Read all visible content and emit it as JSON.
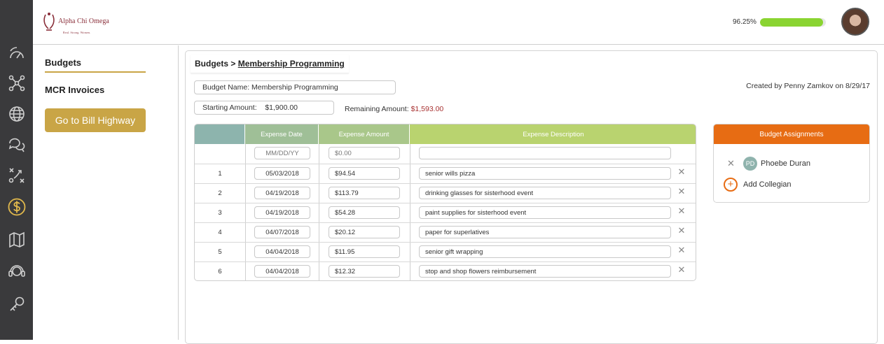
{
  "brand": {
    "name": "Alpha Chi Omega",
    "tagline": "Real. Strong. Women.",
    "accent_gold": "#c9a546",
    "accent_orange": "#e76c13",
    "accent_red": "#a83232"
  },
  "rail": {
    "icons": [
      "dashboard-gauge-icon",
      "network-nodes-icon",
      "globe-icon",
      "chat-bubbles-icon",
      "strategy-play-icon",
      "dollar-coin-icon",
      "book-map-icon",
      "support-headset-icon",
      "key-icon"
    ],
    "active": "dollar-coin-icon"
  },
  "header": {
    "progress_text": "96.25%",
    "progress_value": 0.9625
  },
  "sidenav": {
    "budgets": "Budgets",
    "mcr": "MCR Invoices",
    "bill_button": "Go to Bill Highway"
  },
  "breadcrumb": {
    "root": "Budgets",
    "sep": ">",
    "current": "Membership Programming"
  },
  "budget": {
    "name_label": "Budget Name:",
    "name_value": "Membership Programming",
    "start_label": "Starting Amount:",
    "start_value": "$1,900.00",
    "remaining_label": "Remaining Amount:",
    "remaining_value": "$1,593.00",
    "created": "Created by Penny Zamkov on 8/29/17"
  },
  "table": {
    "columns": [
      "",
      "Expense Date",
      "Expense Amount",
      "Expense Description"
    ],
    "new_row": {
      "date_placeholder": "MM/DD/YY",
      "amount_placeholder": "$0.00",
      "description": ""
    },
    "rows": [
      {
        "num": "1",
        "date": "05/03/2018",
        "amount": "$94.54",
        "description": "senior wills pizza"
      },
      {
        "num": "2",
        "date": "04/19/2018",
        "amount": "$113.79",
        "description": "drinking glasses for sisterhood event"
      },
      {
        "num": "3",
        "date": "04/19/2018",
        "amount": "$54.28",
        "description": "paint supplies for sisterhood event"
      },
      {
        "num": "4",
        "date": "04/07/2018",
        "amount": "$20.12",
        "description": "paper for superlatives"
      },
      {
        "num": "5",
        "date": "04/04/2018",
        "amount": "$11.95",
        "description": "senior gift wrapping"
      },
      {
        "num": "6",
        "date": "04/04/2018",
        "amount": "$12.32",
        "description": "stop and shop flowers reimbursement"
      }
    ],
    "header_colors": [
      "#8db4ad",
      "#9fbf97",
      "#a9c78a",
      "#b9d36f"
    ],
    "remove_glyph": "✕"
  },
  "assignments": {
    "title": "Budget Assignments",
    "assignee_initials": "PD",
    "assignee_name": "Phoebe Duran",
    "remove_glyph": "✕",
    "add_glyph": "+",
    "add_label": "Add Collegian"
  }
}
